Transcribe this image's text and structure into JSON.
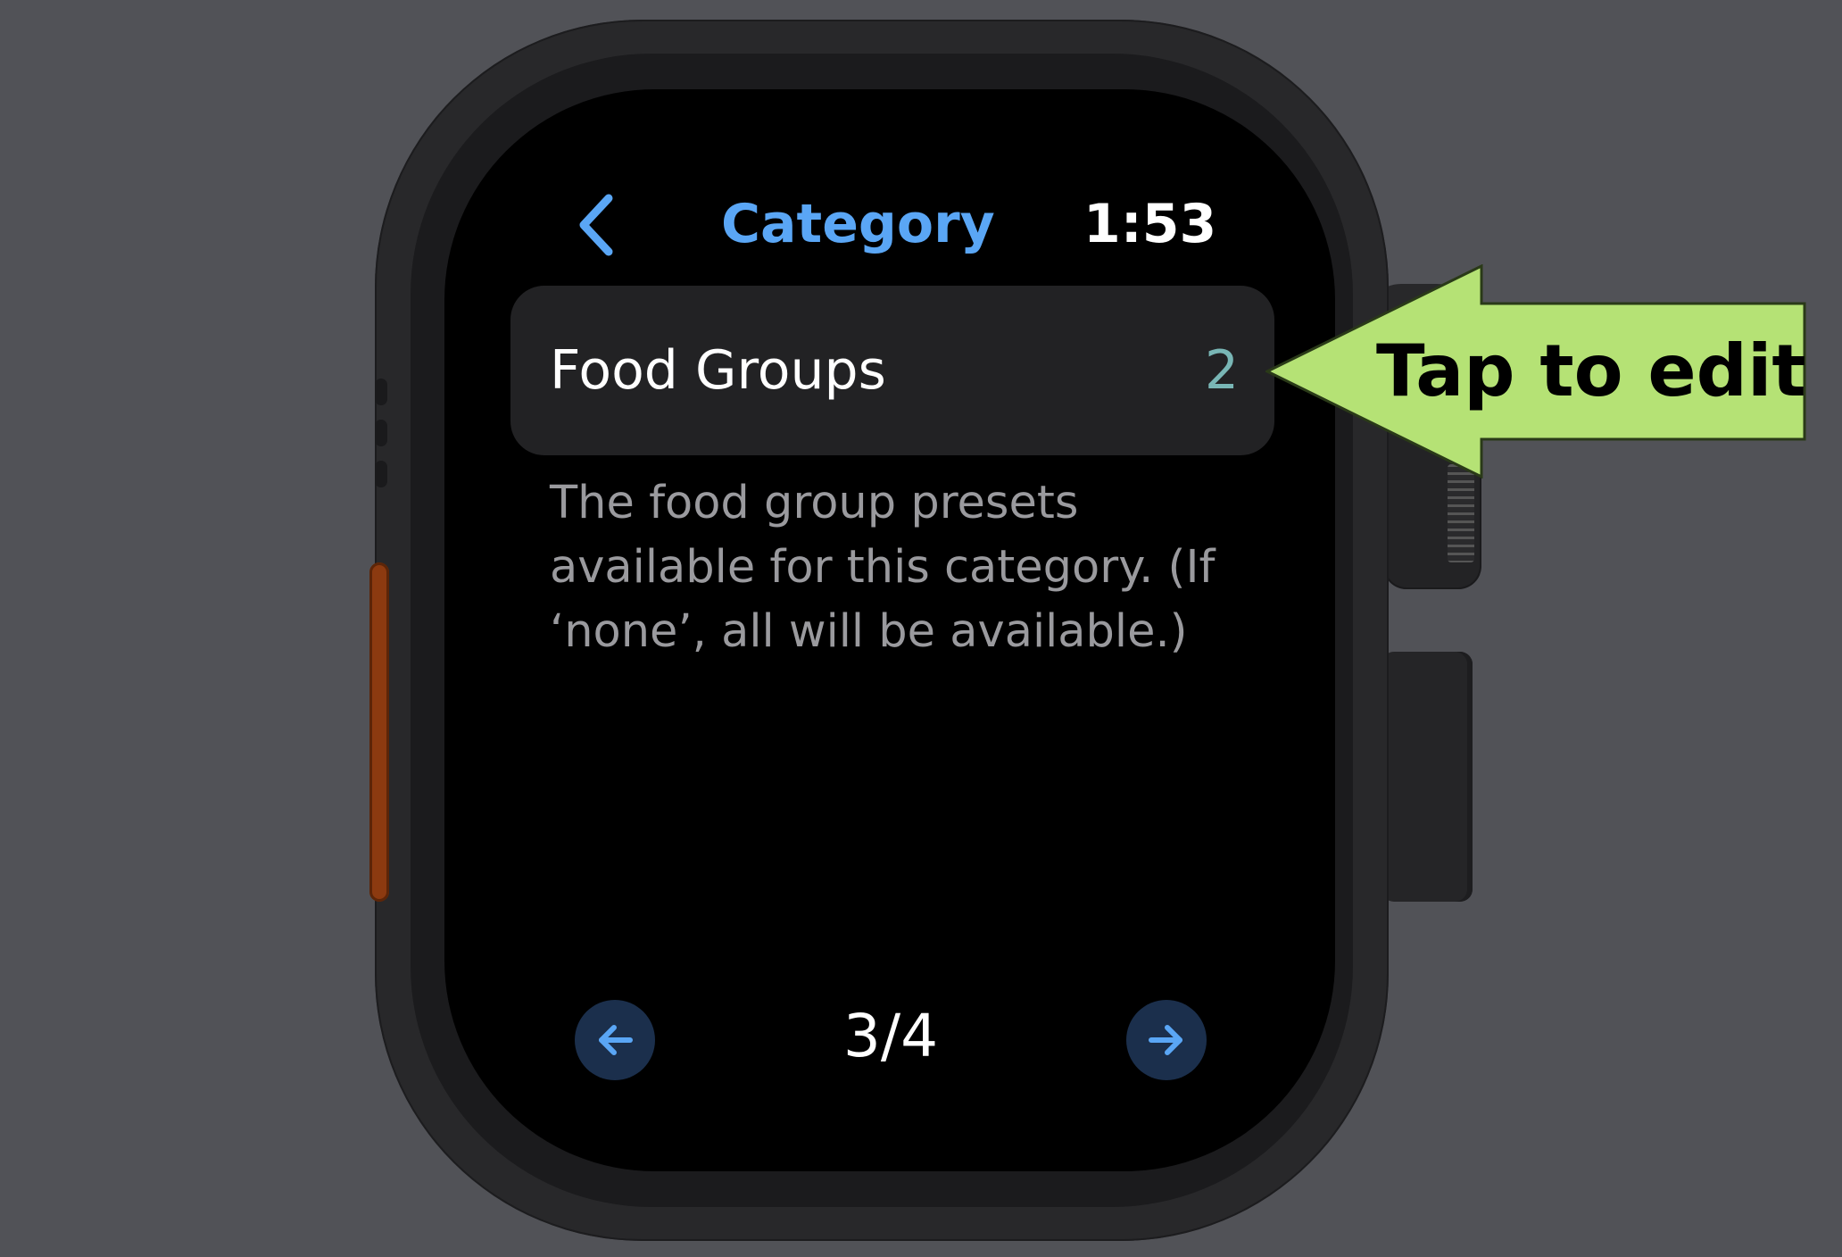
{
  "nav": {
    "back_icon": "chevron-left-icon",
    "title": "Category",
    "time": "1:53"
  },
  "row": {
    "label": "Food Groups",
    "value": "2"
  },
  "footnote": "The food group presets available for this category. (If ‘none’, all will be available.)",
  "pager": {
    "prev_icon": "arrow-left-icon",
    "count": "3/4",
    "next_icon": "arrow-right-icon"
  },
  "callout": {
    "text": "Tap to edit",
    "color": "#b5e275"
  },
  "colors": {
    "accent": "#5aa6f5",
    "value_teal": "#79b6b5",
    "background": "#515257",
    "action_button": "#8c3a10"
  }
}
